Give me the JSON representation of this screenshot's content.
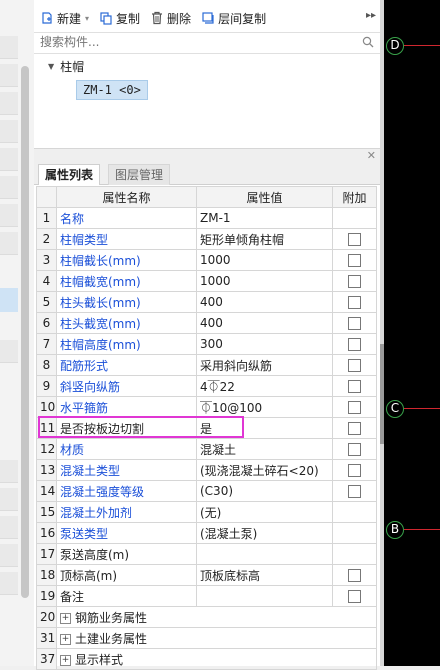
{
  "toolbar": {
    "new_label": "新建",
    "copy_label": "复制",
    "delete_label": "删除",
    "floor_copy_label": "层间复制",
    "more_label": "▸▸"
  },
  "search": {
    "placeholder": "搜索构件..."
  },
  "tree": {
    "root_label": "柱帽",
    "child_label": "ZM-1 <0>"
  },
  "tabs": {
    "properties": "属性列表",
    "layers": "图层管理"
  },
  "table": {
    "headers": {
      "name": "属性名称",
      "value": "属性值",
      "extra": "附加"
    },
    "rows": [
      {
        "num": "1",
        "name": "名称",
        "value": "ZM-1"
      },
      {
        "num": "2",
        "name": "柱帽类型",
        "value": "矩形单倾角柱帽"
      },
      {
        "num": "3",
        "name": "柱帽截长(mm)",
        "value": "1000"
      },
      {
        "num": "4",
        "name": "柱帽截宽(mm)",
        "value": "1000"
      },
      {
        "num": "5",
        "name": "柱头截长(mm)",
        "value": "400"
      },
      {
        "num": "6",
        "name": "柱头截宽(mm)",
        "value": "400"
      },
      {
        "num": "7",
        "name": "柱帽高度(mm)",
        "value": "300"
      },
      {
        "num": "8",
        "name": "配筋形式",
        "value": "采用斜向纵筋"
      },
      {
        "num": "9",
        "name": "斜竖向纵筋",
        "value": "4⏁22"
      },
      {
        "num": "10",
        "name": "水平箍筋",
        "value": "⏁10@100"
      },
      {
        "num": "11",
        "name": "是否按板边切割",
        "value": "是"
      },
      {
        "num": "12",
        "name": "材质",
        "value": "混凝土"
      },
      {
        "num": "13",
        "name": "混凝土类型",
        "value": "(现浇混凝土碎石<20)"
      },
      {
        "num": "14",
        "name": "混凝土强度等级",
        "value": "(C30)"
      },
      {
        "num": "15",
        "name": "混凝土外加剂",
        "value": "(无)"
      },
      {
        "num": "16",
        "name": "泵送类型",
        "value": "(混凝土泵)"
      },
      {
        "num": "17",
        "name": "泵送高度(m)",
        "value": ""
      },
      {
        "num": "18",
        "name": "顶标高(m)",
        "value": "顶板底标高"
      },
      {
        "num": "19",
        "name": "备注",
        "value": ""
      },
      {
        "num": "20",
        "name": "钢筋业务属性",
        "value": ""
      },
      {
        "num": "31",
        "name": "土建业务属性",
        "value": ""
      },
      {
        "num": "37",
        "name": "显示样式",
        "value": ""
      }
    ]
  },
  "canvas": {
    "axes": [
      "D",
      "C",
      "B"
    ]
  },
  "colors": {
    "blue_text": "#1a4fd8",
    "highlight": "#e036d4",
    "axis_line": "#d0272f",
    "axis_marker": "#39a24a",
    "selection": "#cfe3f5"
  }
}
